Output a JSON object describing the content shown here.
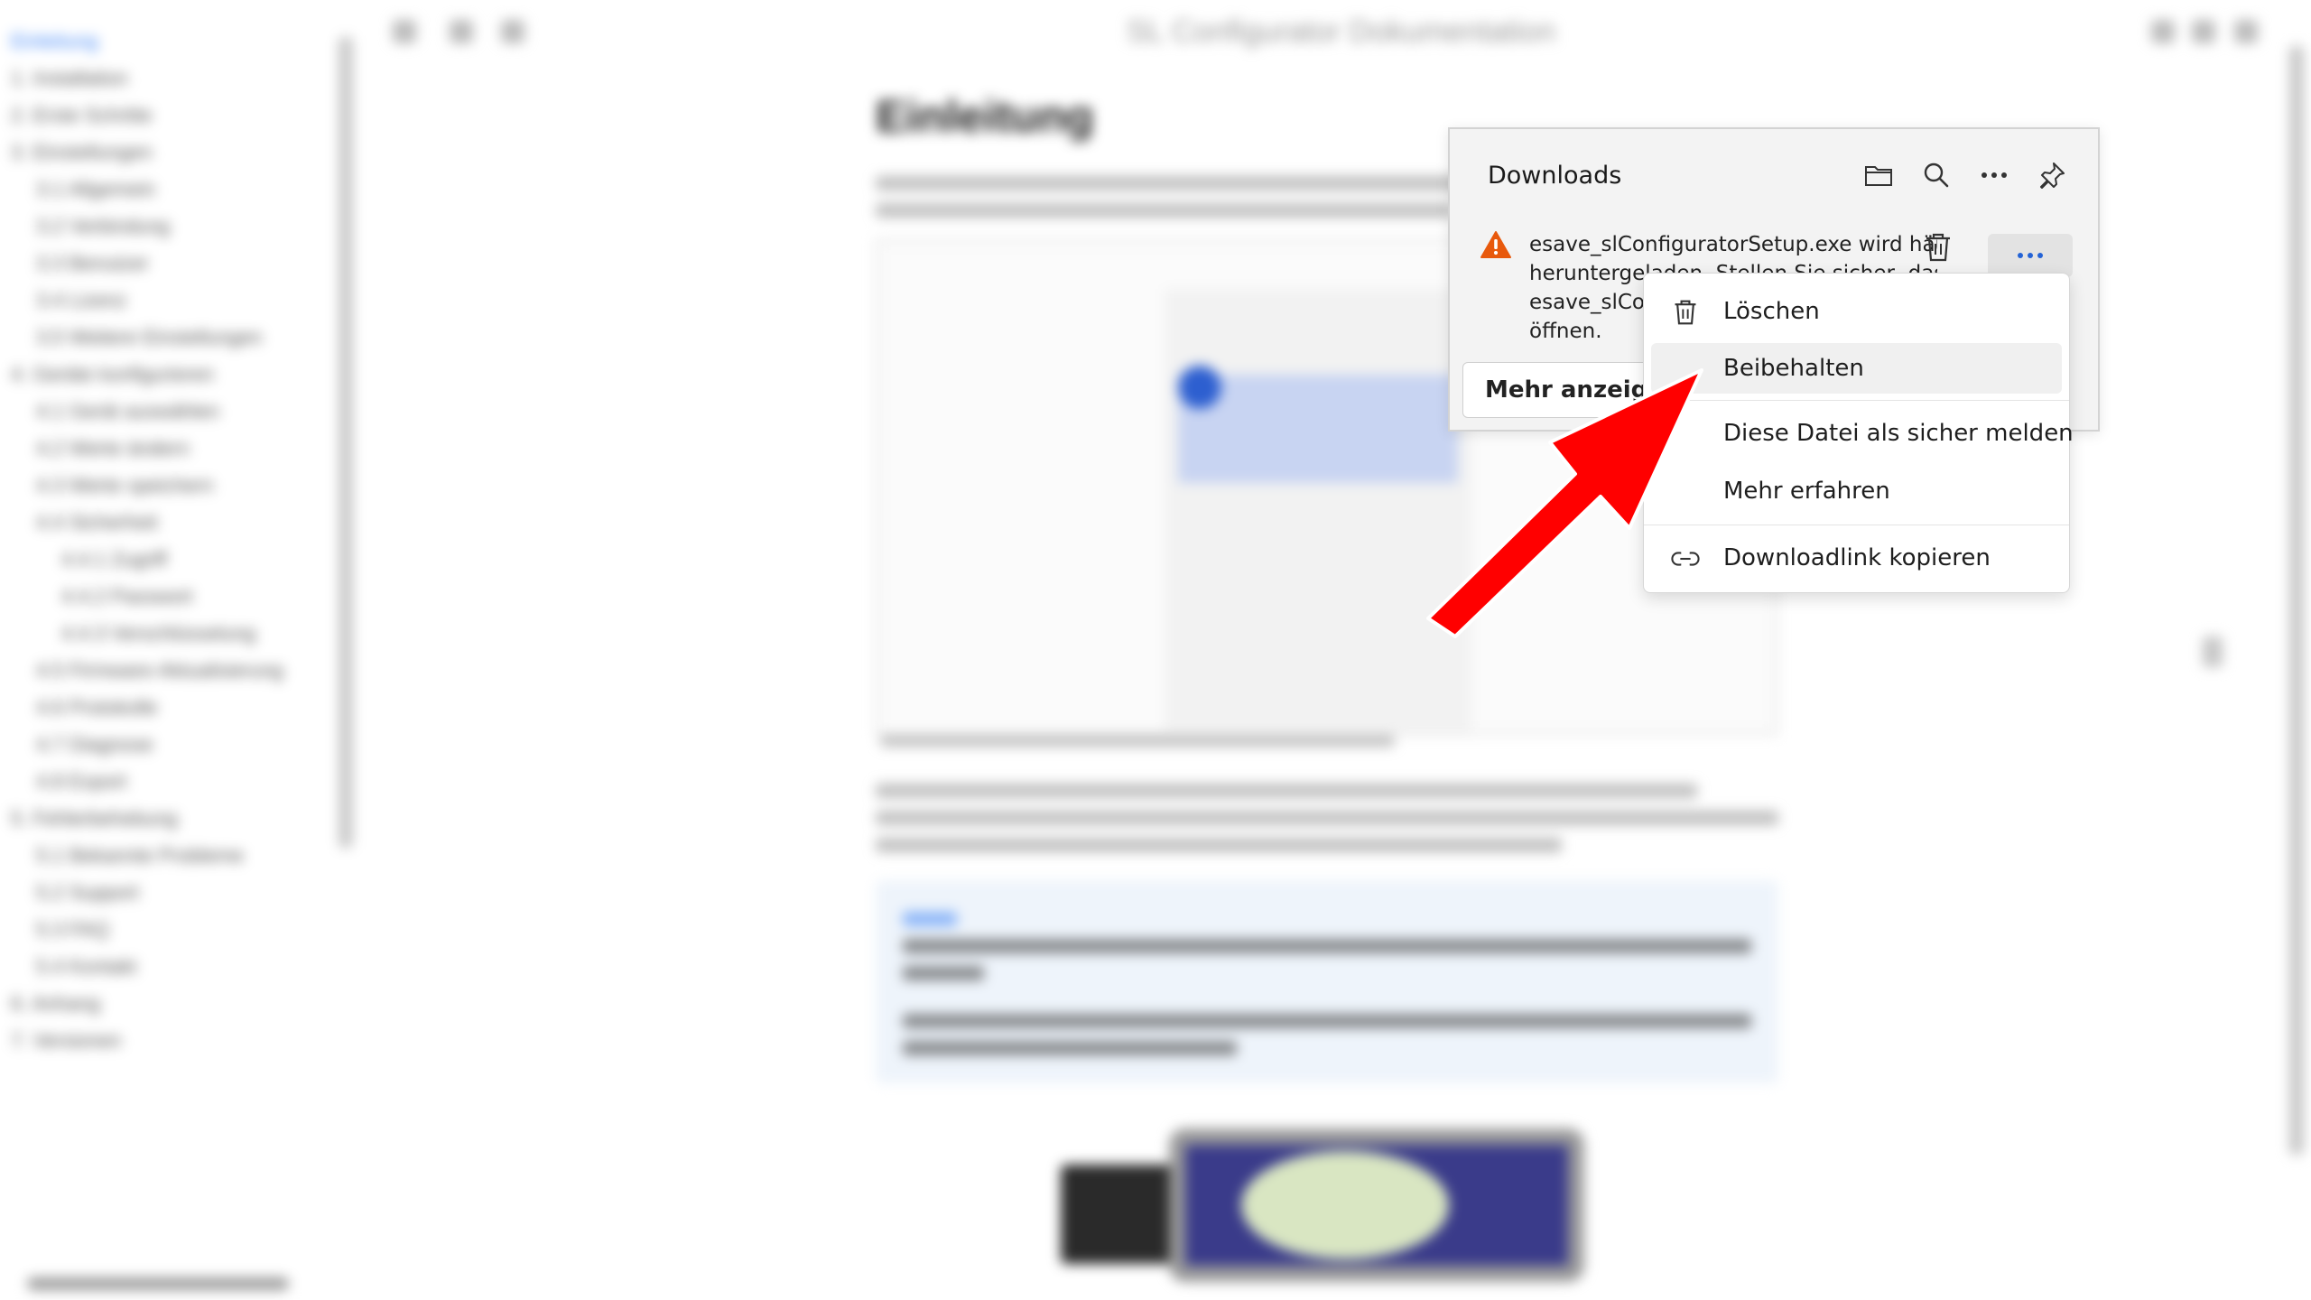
{
  "docs": {
    "window_title": "SL Configurator Dokumentation",
    "heading": "Einleitung"
  },
  "sidebar": {
    "items": [
      {
        "label": "Einleitung",
        "indent": 0,
        "active": true
      },
      {
        "label": "1. Installation",
        "indent": 0
      },
      {
        "label": "2. Erste Schritte",
        "indent": 0
      },
      {
        "label": "3. Einstellungen",
        "indent": 0
      },
      {
        "label": "3.1 Allgemein",
        "indent": 1
      },
      {
        "label": "3.2 Verbindung",
        "indent": 1
      },
      {
        "label": "3.3 Benutzer",
        "indent": 1
      },
      {
        "label": "3.4 Lizenz",
        "indent": 1
      },
      {
        "label": "3.5 Weitere Einstellungen",
        "indent": 1
      },
      {
        "label": "4. Geräte konfigurieren",
        "indent": 0
      },
      {
        "label": "4.1 Gerät auswählen",
        "indent": 1
      },
      {
        "label": "4.2 Werte ändern",
        "indent": 1
      },
      {
        "label": "4.3 Werte speichern",
        "indent": 1
      },
      {
        "label": "4.4 Sicherheit",
        "indent": 1
      },
      {
        "label": "4.4.1 Zugriff",
        "indent": 2
      },
      {
        "label": "4.4.2 Passwort",
        "indent": 2
      },
      {
        "label": "4.4.3 Verschlüsselung",
        "indent": 2
      },
      {
        "label": "4.5 Firmware-Aktualisierung",
        "indent": 1
      },
      {
        "label": "4.6 Protokolle",
        "indent": 1
      },
      {
        "label": "4.7 Diagnose",
        "indent": 1
      },
      {
        "label": "4.8 Export",
        "indent": 1
      },
      {
        "label": "5. Fehlerbehebung",
        "indent": 0
      },
      {
        "label": "5.1 Bekannte Probleme",
        "indent": 1
      },
      {
        "label": "5.2 Support",
        "indent": 1
      },
      {
        "label": "5.3 FAQ",
        "indent": 1
      },
      {
        "label": "5.4 Kontakt",
        "indent": 1
      },
      {
        "label": "6. Anhang",
        "indent": 0
      },
      {
        "label": "7. Versionen",
        "indent": 0
      }
    ]
  },
  "downloads": {
    "title": "Downloads",
    "header_icons": [
      "folder-icon",
      "search-icon",
      "more-icon",
      "pin-icon"
    ],
    "warning_lines": [
      "esave_slConfiguratorSetup.exe wird häufig",
      "heruntergeladen. Stellen Sie sicher, dass S",
      "esave_slConfiguratorSetup.exe vertrauen, bevor Sie sie",
      "öffnen."
    ],
    "more_button_label": "Mehr anzeigen",
    "warning_color": "#e8590c"
  },
  "context_menu": {
    "items": [
      {
        "label": "Löschen",
        "icon": "trash-icon"
      },
      {
        "label": "Beibehalten",
        "icon": "",
        "highlighted": true
      },
      {
        "label": "Diese Datei als sicher melden",
        "icon": ""
      },
      {
        "label": "Mehr erfahren",
        "icon": ""
      },
      {
        "label": "Downloadlink kopieren",
        "icon": "link-icon"
      }
    ]
  },
  "annotation": {
    "arrow_color": "#ff0000",
    "arrow_icon": "red-arrow-icon"
  }
}
